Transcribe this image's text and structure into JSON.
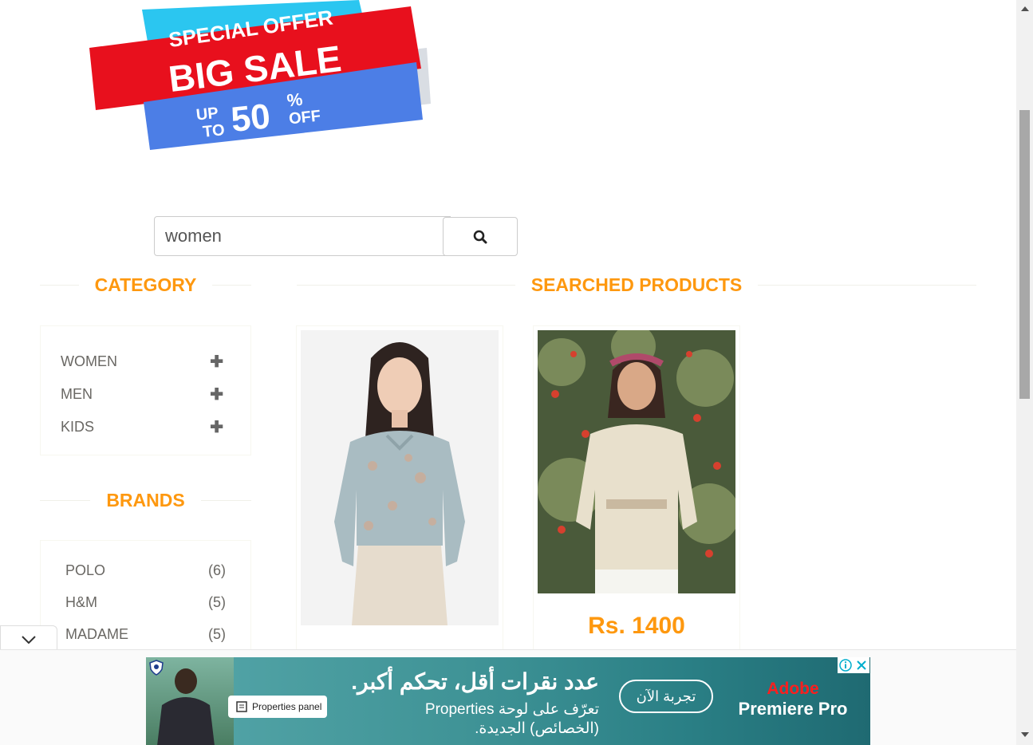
{
  "banner": {
    "line1": "SPECIAL OFFER",
    "line2": "BIG SALE",
    "up": "UP",
    "to": "TO",
    "percent": "50",
    "pct_sign": "%",
    "off": "OFF",
    "colors": {
      "cyan": "#2bc6f0",
      "red": "#e8101d",
      "blue": "#4c7ee6"
    }
  },
  "search": {
    "value": "women",
    "button_icon": "search-icon"
  },
  "sections": {
    "category": "CATEGORY",
    "brands": "BRANDS",
    "searched": "SEARCHED PRODUCTS"
  },
  "categories": [
    {
      "label": "WOMEN",
      "icon": "plus-icon"
    },
    {
      "label": "MEN",
      "icon": "plus-icon"
    },
    {
      "label": "KIDS",
      "icon": "plus-icon"
    }
  ],
  "brands": [
    {
      "label": "POLO",
      "count": "(6)"
    },
    {
      "label": "H&M",
      "count": "(5)"
    },
    {
      "label": "MADAME",
      "count": "(5)"
    }
  ],
  "products": [
    {
      "image": "floral-blouse-photo",
      "price": ""
    },
    {
      "image": "lace-top-photo",
      "price": "Rs. 1400"
    }
  ],
  "ad": {
    "pill": "Properties panel",
    "headline": "عدد نقرات أقل، تحكم أكبر.",
    "sub1": "تعرّف على لوحة Properties",
    "sub2": "(الخصائص) الجديدة.",
    "cta": "تجربة الآن",
    "brand1": "Adobe",
    "brand2": "Premiere Pro"
  },
  "theme": {
    "accent": "#fe980f",
    "text": "#696763"
  }
}
